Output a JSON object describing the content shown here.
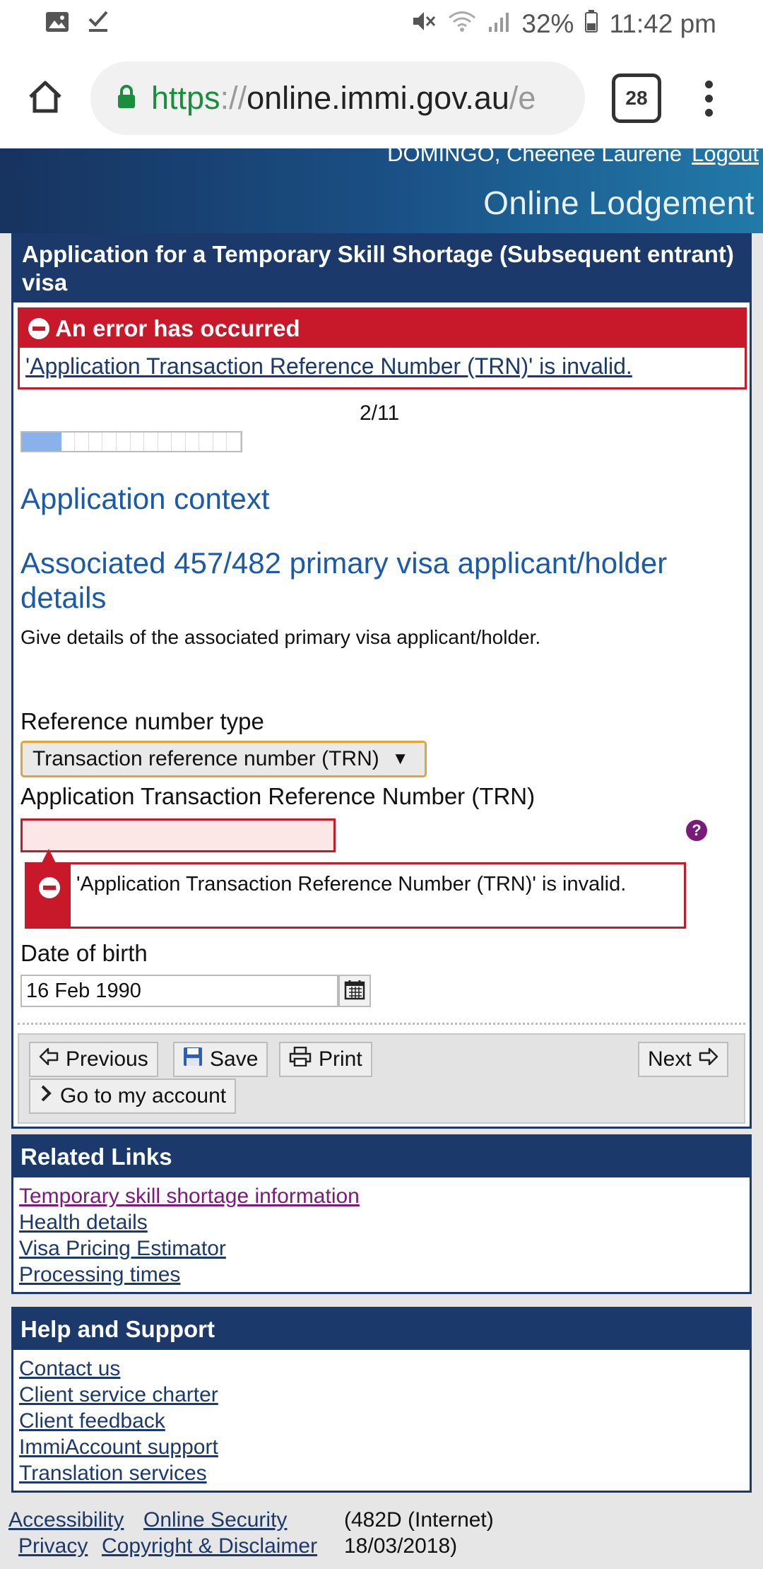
{
  "status_bar": {
    "battery": "32%",
    "time": "11:42 pm"
  },
  "browser": {
    "url_scheme": "https",
    "url_sep": "://",
    "url_host": "online.immi.gov.au",
    "url_rest": "/e",
    "tab_count": "28"
  },
  "header": {
    "user_name": "DOMINGO, Cheenee Laurene",
    "logout": "Logout",
    "site_title": "Online Lodgement"
  },
  "form": {
    "title": "Application for a Temporary Skill Shortage (Subsequent entrant) visa",
    "error_heading": "An error has occurred",
    "error_link": "'Application Transaction Reference Number (TRN)' is invalid.",
    "step": "2/11",
    "progress_fraction": 0.18,
    "section_heading": "Application context",
    "subsection_heading": "Associated 457/482 primary visa applicant/holder details",
    "description": "Give details of the associated primary visa applicant/holder.",
    "ref_type_label": "Reference number type",
    "ref_type_value": "Transaction reference number (TRN)",
    "trn_label": "Application Transaction Reference Number (TRN)",
    "trn_value": "",
    "trn_error": "'Application Transaction Reference Number (TRN)' is invalid.",
    "dob_label": "Date of birth",
    "dob_value": "16 Feb 1990",
    "buttons": {
      "previous": "Previous",
      "save": "Save",
      "print": "Print",
      "next": "Next",
      "account": "Go to my account"
    }
  },
  "related_links": {
    "title": "Related Links",
    "items": [
      "Temporary skill shortage information",
      "Health details",
      "Visa Pricing Estimator",
      "Processing times"
    ]
  },
  "help_support": {
    "title": "Help and Support",
    "items": [
      "Contact us",
      "Client service charter",
      "Client feedback",
      "ImmiAccount support",
      "Translation services"
    ]
  },
  "footer": {
    "accessibility": "Accessibility",
    "online_security": "Online Security",
    "privacy": "Privacy",
    "copyright": "Copyright & Disclaimer",
    "version_line1": "(482D (Internet)",
    "version_line2": "18/03/2018)"
  },
  "colors": {
    "navy": "#1b3a6b",
    "error_red": "#c8192a",
    "heading_blue": "#1a5aa8",
    "visited_link": "#7a1a7a"
  }
}
